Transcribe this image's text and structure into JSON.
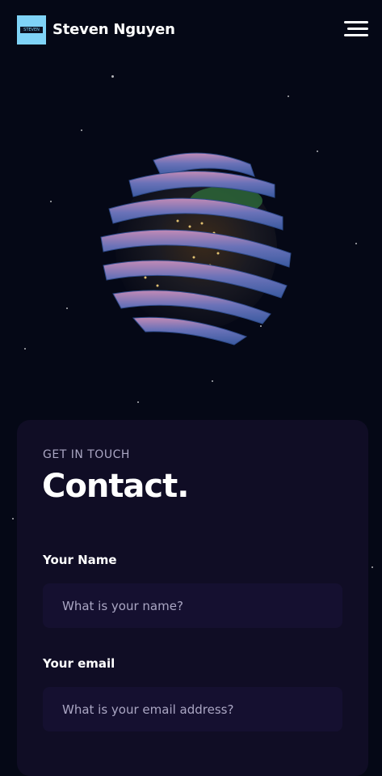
{
  "header": {
    "logo_text": "STEVEN",
    "brand_name": "Steven Nguyen",
    "menu_icon": "hamburger-menu-icon"
  },
  "hero": {
    "graphic": "earth-globe-3d"
  },
  "contact": {
    "eyebrow": "GET IN TOUCH",
    "title": "Contact.",
    "name_label": "Your Name",
    "name_placeholder": "What is your name?",
    "email_label": "Your email",
    "email_placeholder": "What is your email address?"
  },
  "colors": {
    "background": "#050816",
    "card": "#100d25",
    "input": "#151030",
    "secondary_text": "#aaa6c3",
    "logo_bg": "#7fd3f7"
  }
}
